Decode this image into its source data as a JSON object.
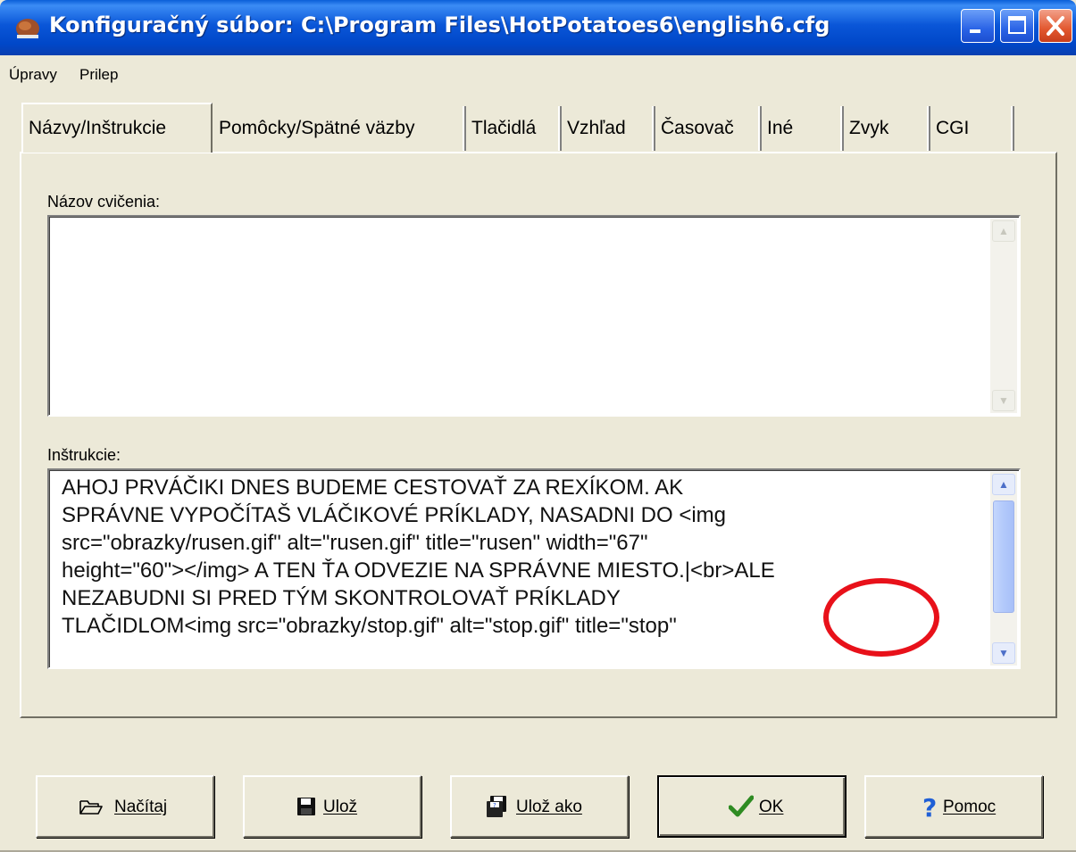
{
  "window": {
    "title": "Konfiguračný súbor: C:\\Program Files\\HotPotatoes6\\english6.cfg",
    "app_icon": "hot-potatoes-icon",
    "controls": [
      "minimize-icon",
      "maximize-icon",
      "close-icon"
    ]
  },
  "menu": {
    "items": [
      "Úpravy",
      "Prilep"
    ]
  },
  "tabs": [
    {
      "label": "Názvy/Inštrukcie",
      "active": true
    },
    {
      "label": "Pomôcky/Spätné väzby",
      "active": false
    },
    {
      "label": "Tlačidlá",
      "active": false
    },
    {
      "label": "Vzhľad",
      "active": false
    },
    {
      "label": "Časovač",
      "active": false
    },
    {
      "label": "Iné",
      "active": false
    },
    {
      "label": "Zvyk",
      "active": false
    },
    {
      "label": "CGI",
      "active": false
    }
  ],
  "fields": {
    "title_label": "Názov cvičenia:",
    "title_value": "",
    "instructions_label": "Inštrukcie:",
    "instructions_value": "AHOJ PRVÁČIKI DNES BUDEME CESTOVAŤ ZA REXÍKOM. AK\nSPRÁVNE VYPOČÍTAŠ VLÁČIKOVÉ PRÍKLADY, NASADNI DO <img\nsrc=\"obrazky/rusen.gif\" alt=\"rusen.gif\" title=\"rusen\" width=\"67\"\nheight=\"60\"></img> A TEN ŤA ODVEZIE NA SPRÁVNE MIESTO.|<br>ALE\nNEZABUDNI SI PRED TÝM SKONTROLOVAŤ PRÍKLADY\nTLAČIDLOM<img src=\"obrazky/stop.gif\" alt=\"stop.gif\" title=\"stop\""
  },
  "buttons": [
    {
      "label": "Načítaj",
      "icon": "open-folder-icon"
    },
    {
      "label": "Ulož",
      "icon": "floppy-disk-icon"
    },
    {
      "label": "Ulož ako",
      "icon": "save-as-icon"
    },
    {
      "label": "OK",
      "icon": "checkmark-icon"
    },
    {
      "label": "Pomoc",
      "icon": "help-icon"
    }
  ],
  "colors": {
    "titlebar": "#0a56d8",
    "dialog_bg": "#ece9d8",
    "annotation_circle": "#e8111a",
    "ok_check": "#2e8b22",
    "help_icon": "#1f5fd6"
  }
}
